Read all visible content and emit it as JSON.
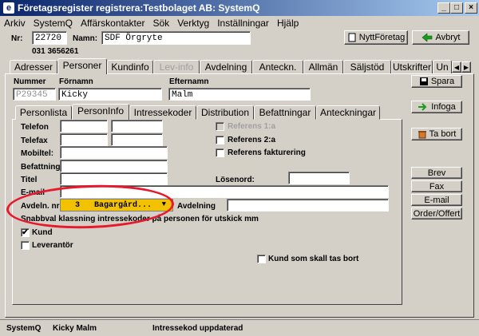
{
  "window": {
    "title": "Företagsregister registrera:Testbolaget AB: SystemQ",
    "app_icon": "e",
    "controls": [
      "_",
      "□",
      "×"
    ]
  },
  "menu": [
    "Arkiv",
    "SystemQ",
    "Affärskontakter",
    "Sök",
    "Verktyg",
    "Inställningar",
    "Hjälp"
  ],
  "header": {
    "nr_label": "Nr:",
    "nr_value": "22720",
    "namn_label": "Namn:",
    "namn_value": "SDF Örgryte",
    "phone": "031 3656261",
    "new_company_label": "NyttFöretag",
    "cancel_label": "Avbryt"
  },
  "main_tabs": [
    "Adresser",
    "Personer",
    "Kundinfo",
    "Lev-info",
    "Avdelning",
    "Anteckn.",
    "Allmän",
    "Säljstöd",
    "Utskrifter",
    "Un"
  ],
  "person": {
    "nummer_label": "Nummer",
    "nummer_placeholder": "P29345",
    "fornamn_label": "Förnamn",
    "fornamn_value": "Kicky",
    "efternamn_label": "Efternamn",
    "efternamn_value": "Malm"
  },
  "sub_tabs": [
    "Personlista",
    "PersonInfo",
    "Intressekoder",
    "Distribution",
    "Befattningar",
    "Anteckningar"
  ],
  "form": {
    "telefon_label": "Telefon",
    "telefax_label": "Telefax",
    "mobiltel_label": "Mobiltel:",
    "befattning_label": "Befattning",
    "titel_label": "Titel",
    "email_label": "E-mail",
    "losenord_label": "Lösenord:",
    "avdeln_nr_label": "Avdeln. nr",
    "avdeln_value": "3   Bagargård...",
    "avdelning_label": "Avdelning",
    "snabbval_label": "Snabbval klassning intressekoder på personen för utskick mm",
    "referens1_label": "Referens 1:a",
    "referens2_label": "Referens 2:a",
    "referens_fakt_label": "Referens fakturering",
    "kund_label": "Kund",
    "leverantor_label": "Leverantör",
    "kund_tas_bort_label": "Kund som skall tas bort"
  },
  "side_buttons": {
    "spara": "Spara",
    "infoga": "Infoga",
    "ta_bort": "Ta bort",
    "brev": "Brev",
    "fax": "Fax",
    "email": "E-mail",
    "order": "Order/Offert"
  },
  "status": {
    "app": "SystemQ",
    "user": "Kicky Malm",
    "message": "Intressekod uppdaterad"
  },
  "colors": {
    "title_start": "#0a246a",
    "annotation": "#e8192c",
    "dropdown_bg": "#f2c200"
  }
}
